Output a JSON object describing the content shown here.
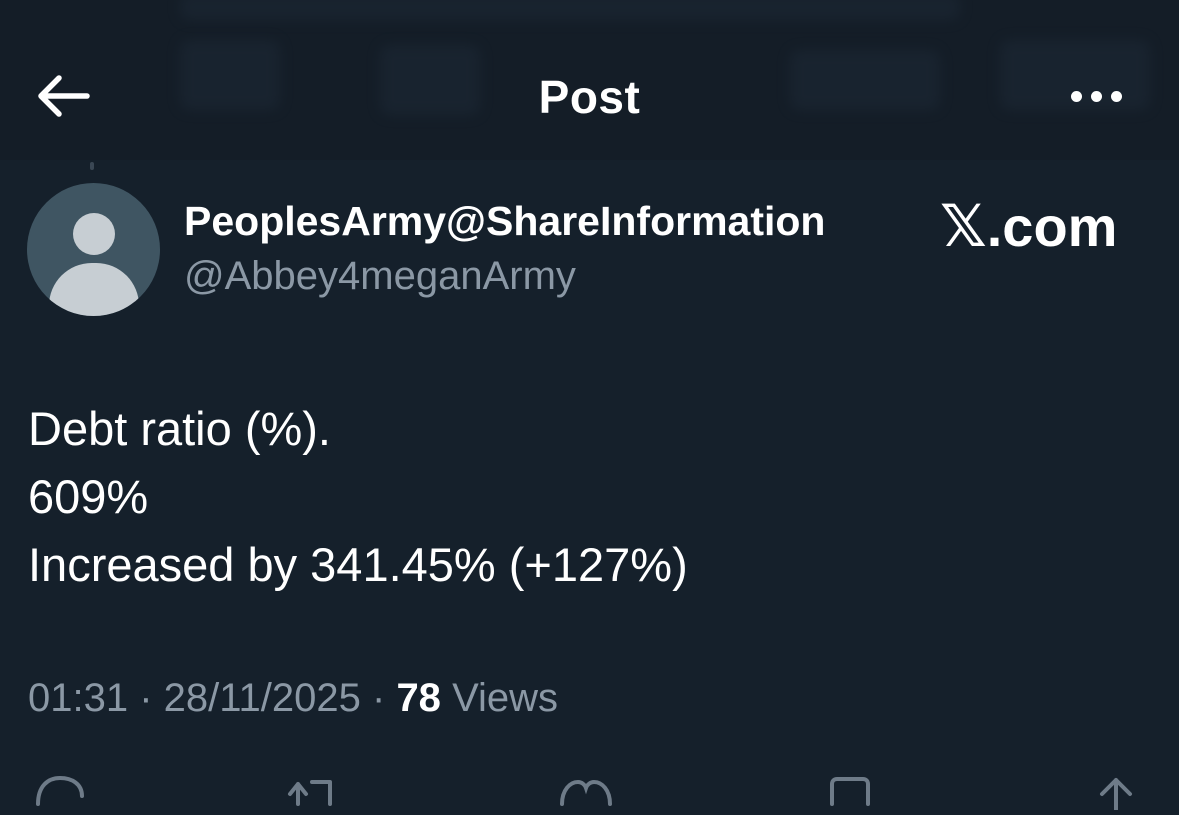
{
  "header": {
    "title": "Post",
    "back_icon": "arrow-left-icon",
    "more_icon": "more-horizontal-icon"
  },
  "author": {
    "display_name": "PeoplesArmy@ShareInformation",
    "handle": "@Abbey4meganArmy",
    "avatar_icon": "default-avatar-icon"
  },
  "watermark": {
    "x_mark": "𝕏",
    "domain": ".com"
  },
  "post": {
    "lines": [
      "Debt ratio (%).",
      "609%",
      "Increased by 341.45% (+127%)"
    ]
  },
  "meta": {
    "time": "01:31",
    "separator": " · ",
    "date": "28/11/2025",
    "views_count": "78",
    "views_label": "Views"
  },
  "actions": {
    "icons": [
      "reply-icon",
      "repost-icon",
      "like-icon",
      "bookmark-icon",
      "share-icon"
    ]
  },
  "colors": {
    "background": "#15202b",
    "text_primary": "#ffffff",
    "text_secondary": "#8b98a5",
    "avatar_bg": "#3f5562"
  }
}
